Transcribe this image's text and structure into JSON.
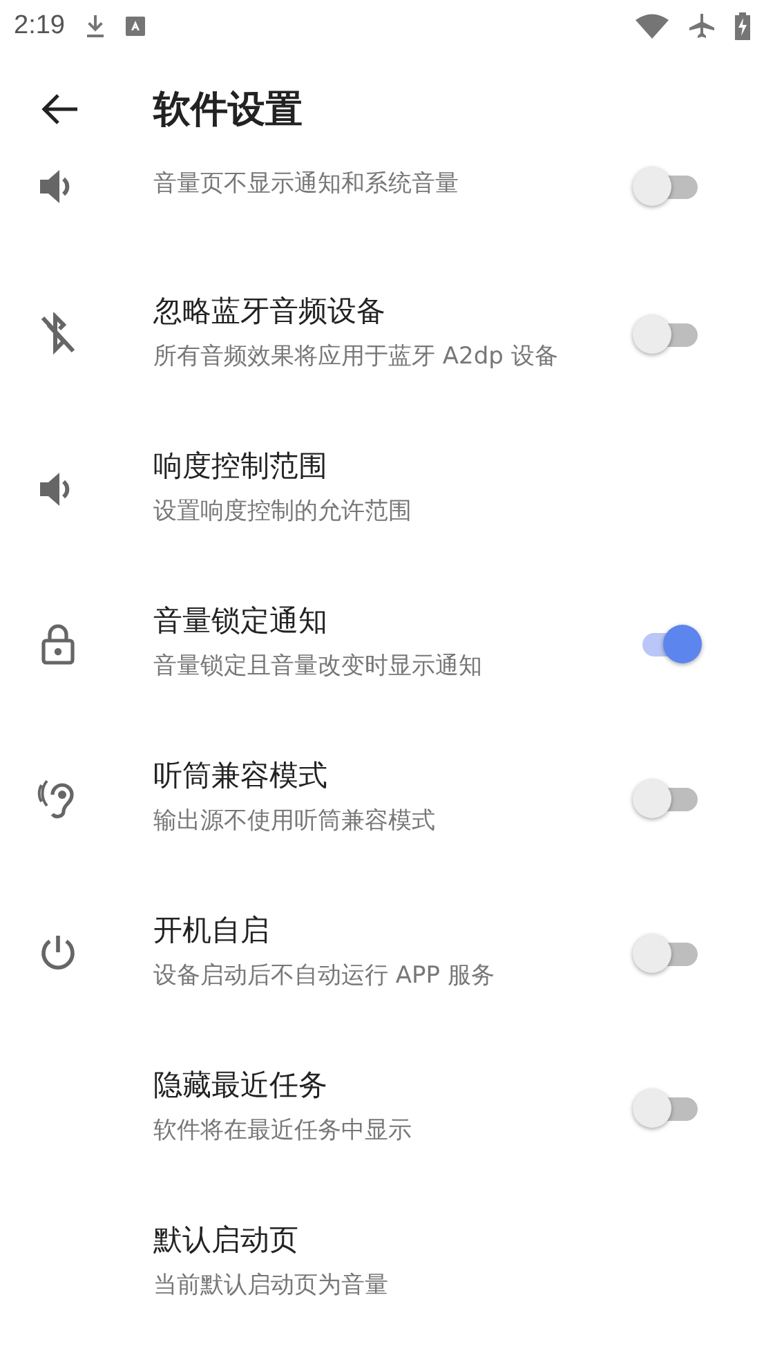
{
  "status_bar": {
    "time": "2:19"
  },
  "app_bar": {
    "title": "软件设置"
  },
  "settings": [
    {
      "subtitle": "音量页不显示通知和系统音量",
      "kind": "switch",
      "on": false
    },
    {
      "title": "忽略蓝牙音频设备",
      "subtitle": "所有音频效果将应用于蓝牙 A2dp 设备",
      "kind": "switch",
      "on": false
    },
    {
      "title": "响度控制范围",
      "subtitle": "设置响度控制的允许范围",
      "kind": "plain"
    },
    {
      "title": "音量锁定通知",
      "subtitle": "音量锁定且音量改变时显示通知",
      "kind": "switch",
      "on": true
    },
    {
      "title": "听筒兼容模式",
      "subtitle": "输出源不使用听筒兼容模式",
      "kind": "switch",
      "on": false
    },
    {
      "title": "开机自启",
      "subtitle": "设备启动后不自动运行 APP 服务",
      "kind": "switch",
      "on": false
    },
    {
      "title": "隐藏最近任务",
      "subtitle": "软件将在最近任务中显示",
      "kind": "switch",
      "on": false
    },
    {
      "title": "默认启动页",
      "subtitle": "当前默认启动页为音量",
      "kind": "plain"
    }
  ]
}
